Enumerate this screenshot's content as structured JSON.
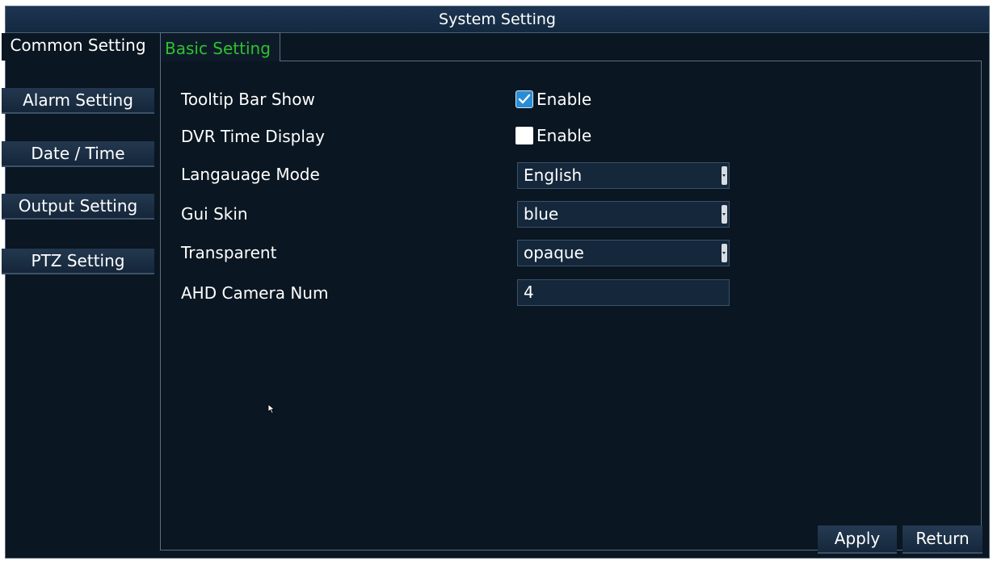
{
  "window": {
    "title": "System Setting"
  },
  "sidebar": {
    "items": [
      {
        "label": "Common Setting",
        "active": true
      },
      {
        "label": "Alarm Setting",
        "active": false
      },
      {
        "label": "Date / Time",
        "active": false
      },
      {
        "label": "Output Setting",
        "active": false
      },
      {
        "label": "PTZ Setting",
        "active": false
      }
    ]
  },
  "tabs": {
    "basic_setting": "Basic Setting"
  },
  "form": {
    "tooltip_bar_show": {
      "label": "Tooltip Bar Show",
      "checkbox_label": "Enable",
      "checked": true
    },
    "dvr_time_display": {
      "label": "DVR Time Display",
      "checkbox_label": "Enable",
      "checked": false
    },
    "language_mode": {
      "label": "Langauage Mode",
      "value": "English"
    },
    "gui_skin": {
      "label": "Gui Skin",
      "value": "blue"
    },
    "transparent": {
      "label": "Transparent",
      "value": "opaque"
    },
    "ahd_camera_num": {
      "label": "AHD Camera Num",
      "value": "4"
    }
  },
  "footer": {
    "apply_label": "Apply",
    "return_label": "Return"
  },
  "colors": {
    "background": "#0a1621",
    "active_tab_text": "#2fc12f",
    "checkbox_accent": "#2a8dd4",
    "border": "#5c6f83"
  },
  "icons": {
    "checkmark": "check-icon",
    "dropdown": "dropdown-arrow-icon",
    "pointer": "mouse-cursor-icon"
  }
}
